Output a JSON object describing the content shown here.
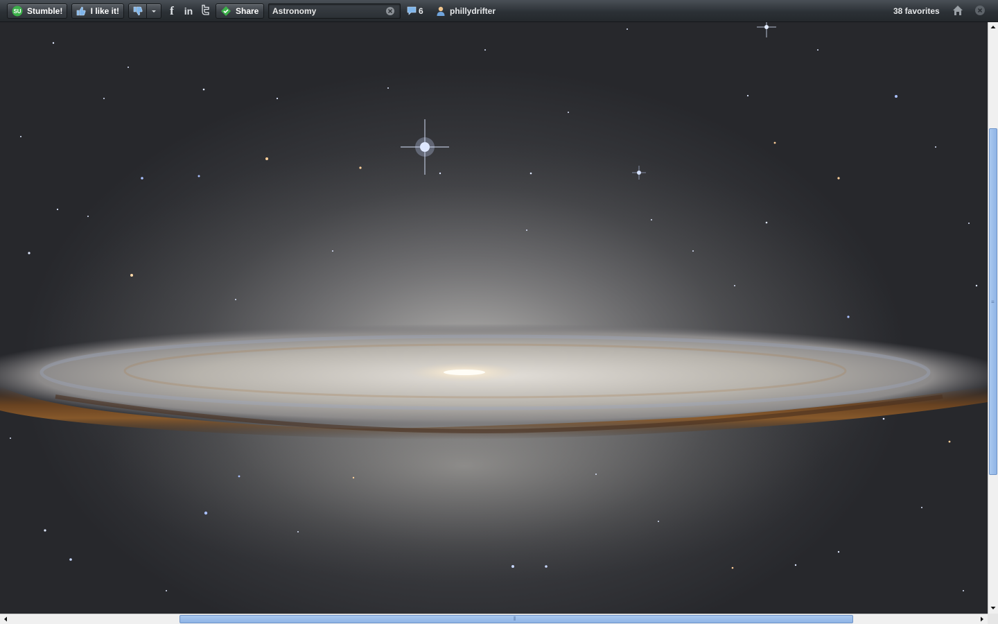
{
  "toolbar": {
    "stumble_label": "Stumble!",
    "stumble_icon": "stumbleupon-logo-icon",
    "like_label": "I like it!",
    "like_icon": "thumbs-up-icon",
    "dislike_icon": "thumbs-down-icon",
    "dropdown_icon": "chevron-down-icon",
    "social": [
      {
        "name": "facebook",
        "glyph": "f"
      },
      {
        "name": "linkedin",
        "glyph": "in"
      },
      {
        "name": "twitter",
        "glyph": "t"
      }
    ],
    "share_label": "Share",
    "share_icon": "share-diamond-icon",
    "topic_value": "Astronomy",
    "clear_icon": "close-circle-icon",
    "comments_count": "6",
    "comments_icon": "speech-bubble-icon",
    "username": "phillydrifter",
    "user_icon": "user-icon",
    "favorites_text": "38 favorites",
    "home_icon": "home-icon",
    "close_icon": "close-circle-icon"
  },
  "content": {
    "image_subject": "galaxy-photo",
    "colors": {
      "background": "#2a2b2f",
      "dust_lane": "#6b4320",
      "core": "#fff6e4",
      "scroll_thumb": "#9dbeea"
    }
  },
  "scrollbars": {
    "vertical_fraction_visible": 0.59,
    "horizontal_fraction_visible": 0.68
  }
}
